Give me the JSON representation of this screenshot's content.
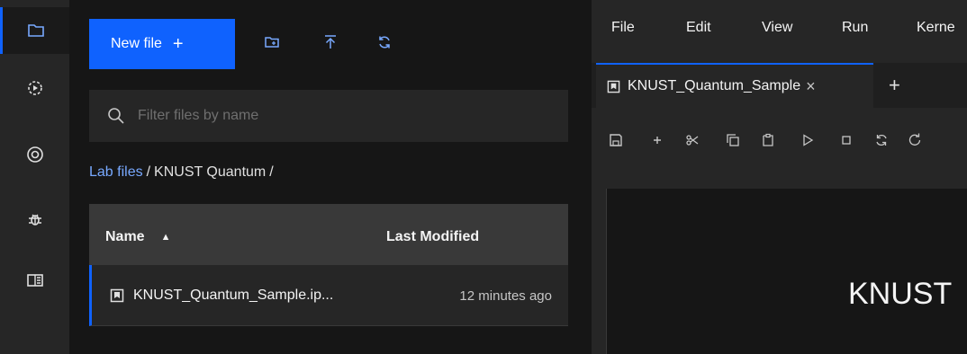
{
  "activity_bar": {
    "items": [
      {
        "icon": "folder-icon"
      },
      {
        "icon": "running-icon"
      },
      {
        "icon": "palette-icon"
      },
      {
        "icon": "debugger-icon"
      },
      {
        "icon": "table-of-contents-icon"
      }
    ]
  },
  "file_browser": {
    "new_file_label": "New file",
    "new_file_plus": "+",
    "search_placeholder": "Filter files by name",
    "breadcrumb": {
      "root": "Lab files",
      "sep1": "/",
      "folder": "KNUST Quantum",
      "sep2": "/"
    },
    "columns": {
      "name": "Name",
      "modified": "Last Modified",
      "sort_glyph": "▲"
    },
    "files": [
      {
        "name": "KNUST_Quantum_Sample.ip...",
        "modified": "12 minutes ago"
      }
    ]
  },
  "menubar": {
    "items": [
      "File",
      "Edit",
      "View",
      "Run",
      "Kerne"
    ]
  },
  "tabs": [
    {
      "label": "KNUST_Quantum_Sample",
      "close": "×"
    }
  ],
  "tab_add": "+",
  "notebook": {
    "visible_heading": "KNUST"
  },
  "colors": {
    "accent": "#0f62fe",
    "link": "#78a9ff"
  }
}
